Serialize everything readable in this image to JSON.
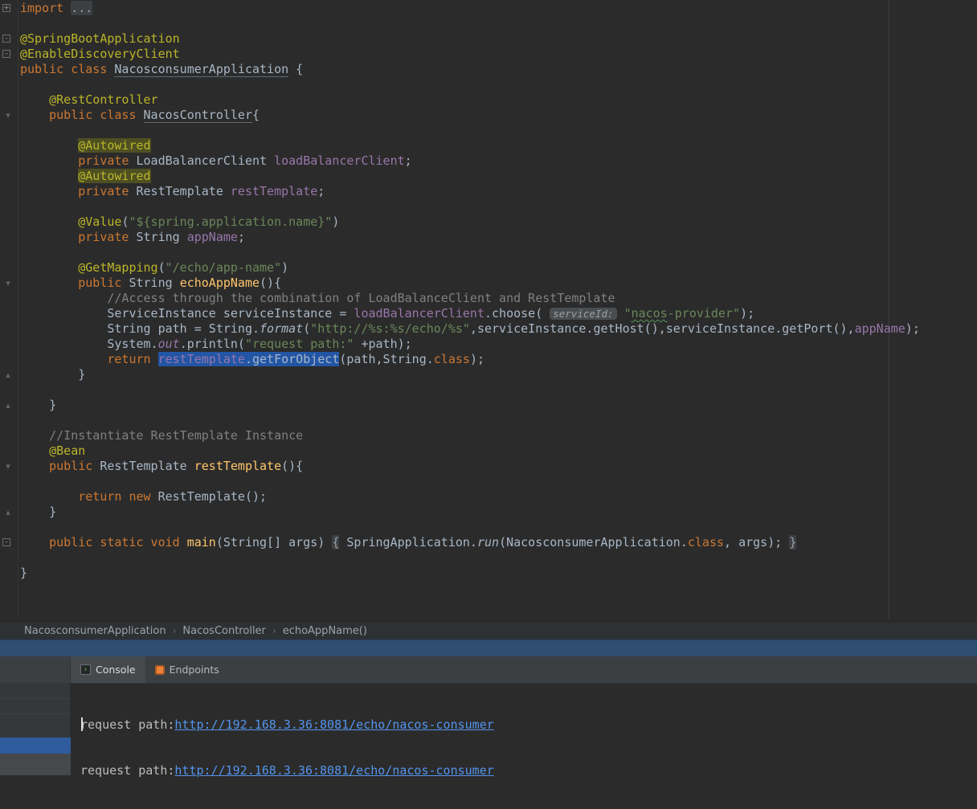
{
  "colors": {
    "editor_bg": "#2b2b2b",
    "toolbar_bg": "#3c3f41",
    "keyword": "#cc7832",
    "annotation": "#bbb529",
    "string": "#6a8759",
    "comment": "#808080",
    "text": "#a9b7c6",
    "field": "#9876aa",
    "method_decl": "#ffc66b",
    "folded_bg": "#3d4043",
    "hint_bg": "#4b4e50",
    "selection_bg": "#2255a5",
    "autowired_highlight_bg": "#4e5022",
    "link": "#5394ec",
    "header_band": "#2f4e70",
    "selected_block": "#2e5c9d"
  },
  "editor": {
    "lines": [
      {
        "tokens": [
          {
            "t": "import ",
            "c": "kw"
          },
          {
            "t": "...",
            "c": "fold"
          }
        ]
      },
      {
        "tokens": []
      },
      {
        "tokens": [
          {
            "t": "@SpringBootApplication",
            "c": "ann"
          }
        ]
      },
      {
        "tokens": [
          {
            "t": "@EnableDiscoveryClient",
            "c": "ann"
          }
        ]
      },
      {
        "tokens": [
          {
            "t": "public class ",
            "c": "kw"
          },
          {
            "t": "NacosconsumerApplication",
            "c": "def u"
          },
          {
            "t": " {",
            "c": "def"
          }
        ]
      },
      {
        "tokens": []
      },
      {
        "tokens": [
          {
            "t": "    ",
            "c": "def"
          },
          {
            "t": "@RestController",
            "c": "ann"
          }
        ]
      },
      {
        "tokens": [
          {
            "t": "    ",
            "c": "def"
          },
          {
            "t": "public class ",
            "c": "kw"
          },
          {
            "t": "NacosController",
            "c": "def u"
          },
          {
            "t": "{",
            "c": "def"
          }
        ]
      },
      {
        "tokens": []
      },
      {
        "tokens": [
          {
            "t": "        ",
            "c": "def"
          },
          {
            "t": "@Autowired",
            "c": "ann hl"
          }
        ]
      },
      {
        "tokens": [
          {
            "t": "        ",
            "c": "def"
          },
          {
            "t": "private ",
            "c": "kw"
          },
          {
            "t": "LoadBalancerClient ",
            "c": "def"
          },
          {
            "t": "loadBalancerClient",
            "c": "fld"
          },
          {
            "t": ";",
            "c": "def"
          }
        ]
      },
      {
        "tokens": [
          {
            "t": "        ",
            "c": "def"
          },
          {
            "t": "@Autowired",
            "c": "ann hl"
          }
        ]
      },
      {
        "tokens": [
          {
            "t": "        ",
            "c": "def"
          },
          {
            "t": "private ",
            "c": "kw"
          },
          {
            "t": "RestTemplate ",
            "c": "def"
          },
          {
            "t": "restTemplate",
            "c": "fld"
          },
          {
            "t": ";",
            "c": "def"
          }
        ]
      },
      {
        "tokens": []
      },
      {
        "tokens": [
          {
            "t": "        ",
            "c": "def"
          },
          {
            "t": "@Value",
            "c": "ann"
          },
          {
            "t": "(",
            "c": "def"
          },
          {
            "t": "\"${spring.application.name}\"",
            "c": "str"
          },
          {
            "t": ")",
            "c": "def"
          }
        ]
      },
      {
        "tokens": [
          {
            "t": "        ",
            "c": "def"
          },
          {
            "t": "private ",
            "c": "kw"
          },
          {
            "t": "String ",
            "c": "def"
          },
          {
            "t": "appName",
            "c": "fld"
          },
          {
            "t": ";",
            "c": "def"
          }
        ]
      },
      {
        "tokens": []
      },
      {
        "tokens": [
          {
            "t": "        ",
            "c": "def"
          },
          {
            "t": "@GetMapping",
            "c": "ann"
          },
          {
            "t": "(",
            "c": "def"
          },
          {
            "t": "\"/echo/app-name\"",
            "c": "str"
          },
          {
            "t": ")",
            "c": "def"
          }
        ]
      },
      {
        "tokens": [
          {
            "t": "        ",
            "c": "def"
          },
          {
            "t": "public ",
            "c": "kw"
          },
          {
            "t": "String ",
            "c": "def"
          },
          {
            "t": "echoAppName",
            "c": "mth"
          },
          {
            "t": "(){",
            "c": "def"
          }
        ]
      },
      {
        "tokens": [
          {
            "t": "            ",
            "c": "def"
          },
          {
            "t": "//Access through the combination of LoadBalanceClient and RestTemplate",
            "c": "cmt"
          }
        ]
      },
      {
        "tokens": [
          {
            "t": "            ",
            "c": "def"
          },
          {
            "t": "ServiceInstance serviceInstance = ",
            "c": "def"
          },
          {
            "t": "loadBalancerClient",
            "c": "fld"
          },
          {
            "t": ".choose( ",
            "c": "def"
          },
          {
            "t": "serviceId:",
            "c": "hint"
          },
          {
            "t": " ",
            "c": "def"
          },
          {
            "t": "\"",
            "c": "str"
          },
          {
            "t": "nacos",
            "c": "str wavy"
          },
          {
            "t": "-provider\"",
            "c": "str"
          },
          {
            "t": ");",
            "c": "def"
          }
        ]
      },
      {
        "tokens": [
          {
            "t": "            ",
            "c": "def"
          },
          {
            "t": "String path = String.",
            "c": "def"
          },
          {
            "t": "format",
            "c": "def it"
          },
          {
            "t": "(",
            "c": "def"
          },
          {
            "t": "\"http://%s:%s/echo/%s\"",
            "c": "str"
          },
          {
            "t": ",serviceInstance.getHost(),serviceInstance.getPort(),",
            "c": "def"
          },
          {
            "t": "appName",
            "c": "fld"
          },
          {
            "t": ");",
            "c": "def"
          }
        ]
      },
      {
        "tokens": [
          {
            "t": "            ",
            "c": "def"
          },
          {
            "t": "System.",
            "c": "def"
          },
          {
            "t": "out",
            "c": "fld it"
          },
          {
            "t": ".println(",
            "c": "def"
          },
          {
            "t": "\"request path:\"",
            "c": "str"
          },
          {
            "t": " +path);",
            "c": "def"
          }
        ]
      },
      {
        "tokens": [
          {
            "t": "            ",
            "c": "def"
          },
          {
            "t": "return ",
            "c": "kw"
          },
          {
            "t": "restTemplate",
            "c": "fld sel"
          },
          {
            "t": ".getForObject",
            "c": "def sel"
          },
          {
            "t": "(path,String.",
            "c": "def"
          },
          {
            "t": "class",
            "c": "kw"
          },
          {
            "t": ");",
            "c": "def"
          }
        ]
      },
      {
        "tokens": [
          {
            "t": "        }",
            "c": "def"
          }
        ]
      },
      {
        "tokens": []
      },
      {
        "tokens": [
          {
            "t": "    }",
            "c": "def"
          }
        ]
      },
      {
        "tokens": []
      },
      {
        "tokens": [
          {
            "t": "    ",
            "c": "def"
          },
          {
            "t": "//Instantiate RestTemplate Instance",
            "c": "cmt"
          }
        ]
      },
      {
        "tokens": [
          {
            "t": "    ",
            "c": "def"
          },
          {
            "t": "@Bean",
            "c": "ann"
          }
        ]
      },
      {
        "tokens": [
          {
            "t": "    ",
            "c": "def"
          },
          {
            "t": "public ",
            "c": "kw"
          },
          {
            "t": "RestTemplate ",
            "c": "def"
          },
          {
            "t": "restTemplate",
            "c": "mth"
          },
          {
            "t": "(){",
            "c": "def"
          }
        ]
      },
      {
        "tokens": []
      },
      {
        "tokens": [
          {
            "t": "        ",
            "c": "def"
          },
          {
            "t": "return new ",
            "c": "kw"
          },
          {
            "t": "RestTemplate();",
            "c": "def"
          }
        ]
      },
      {
        "tokens": [
          {
            "t": "    }",
            "c": "def"
          }
        ]
      },
      {
        "tokens": []
      },
      {
        "tokens": [
          {
            "t": "    ",
            "c": "def"
          },
          {
            "t": "public static void ",
            "c": "kw"
          },
          {
            "t": "main",
            "c": "mth"
          },
          {
            "t": "(String[] args) ",
            "c": "def"
          },
          {
            "t": "{",
            "c": "fold"
          },
          {
            "t": " SpringApplication.",
            "c": "def"
          },
          {
            "t": "run",
            "c": "def it"
          },
          {
            "t": "(NacosconsumerApplication.",
            "c": "def"
          },
          {
            "t": "class",
            "c": "kw"
          },
          {
            "t": ", args); ",
            "c": "def"
          },
          {
            "t": "}",
            "c": "fold"
          }
        ]
      },
      {
        "tokens": []
      },
      {
        "tokens": [
          {
            "t": "}",
            "c": "def"
          }
        ]
      }
    ],
    "gutter_icons": [
      {
        "line": 0,
        "type": "box",
        "glyph": "+"
      },
      {
        "line": 2,
        "type": "box",
        "glyph": "-"
      },
      {
        "line": 3,
        "type": "box",
        "glyph": "-"
      },
      {
        "line": 7,
        "type": "arrow-down"
      },
      {
        "line": 18,
        "type": "arrow-down"
      },
      {
        "line": 24,
        "type": "arrow-up"
      },
      {
        "line": 26,
        "type": "arrow-up"
      },
      {
        "line": 30,
        "type": "arrow-down"
      },
      {
        "line": 33,
        "type": "arrow-up"
      },
      {
        "line": 35,
        "type": "box",
        "glyph": "-"
      }
    ]
  },
  "breadcrumbs": {
    "separator": "›",
    "items": [
      "NacosconsumerApplication",
      "NacosController",
      "echoAppName()"
    ]
  },
  "run_toolwindow": {
    "tabs": [
      {
        "label": "Console",
        "icon": "console-icon",
        "selected": true
      },
      {
        "label": "Endpoints",
        "icon": "endpoints-icon",
        "selected": false
      }
    ],
    "console_lines": [
      {
        "prefix": "request path:",
        "link": "http://192.168.3.36:8081/echo/nacos-consumer"
      },
      {
        "prefix": "request path:",
        "link": "http://192.168.3.36:8081/echo/nacos-consumer"
      }
    ]
  }
}
